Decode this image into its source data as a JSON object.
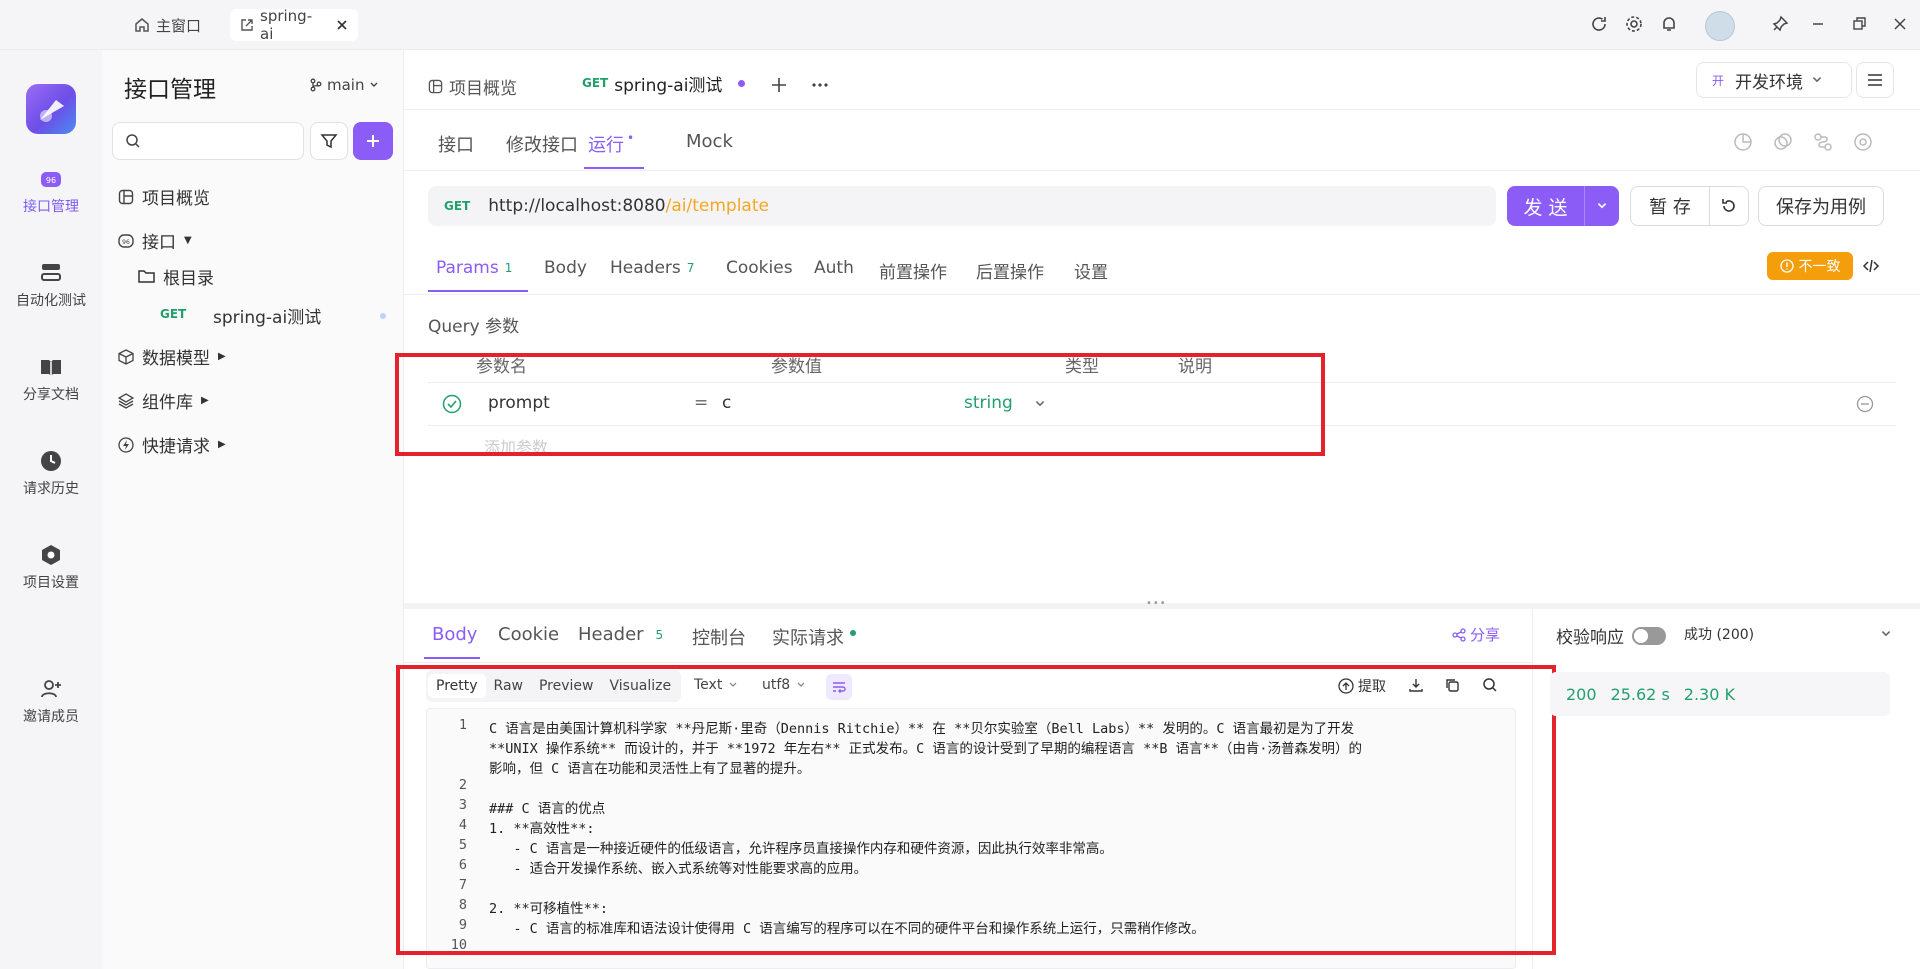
{
  "titlebar": {
    "home_tab": "主窗口",
    "doc_tab": "spring-ai"
  },
  "rail": {
    "items": [
      {
        "label": "接口管理",
        "icon": "api-management-icon"
      },
      {
        "label": "自动化测试",
        "icon": "automation-test-icon"
      },
      {
        "label": "分享文档",
        "icon": "share-docs-icon"
      },
      {
        "label": "请求历史",
        "icon": "history-icon"
      },
      {
        "label": "项目设置",
        "icon": "project-settings-icon"
      },
      {
        "label": "邀请成员",
        "icon": "invite-member-icon"
      }
    ]
  },
  "sidebar": {
    "title": "接口管理",
    "branch": "main",
    "search_placeholder": "",
    "tree": {
      "overview": "项目概览",
      "api": "接口",
      "root": "根目录",
      "endpoint_method": "GET",
      "endpoint_name": "spring-ai测试",
      "data_model": "数据模型",
      "components": "组件库",
      "quick_request": "快捷请求"
    }
  },
  "header": {
    "overview_tab": "项目概览",
    "active_tab_method": "GET",
    "active_tab_name": "spring-ai测试",
    "env_badge": "开",
    "env_name": "开发环境"
  },
  "subtabs": [
    "接口",
    "修改接口",
    "运行",
    "Mock"
  ],
  "request": {
    "method": "GET",
    "url_base": "http://localhost:8080",
    "url_path": "/ai/template",
    "send": "发 送",
    "save_temp": "暂 存",
    "save_case": "保存为用例"
  },
  "param_tabs": {
    "params": "Params",
    "params_count": "1",
    "body": "Body",
    "headers": "Headers",
    "headers_count": "7",
    "cookies": "Cookies",
    "auth": "Auth",
    "pre": "前置操作",
    "post": "后置操作",
    "settings": "设置",
    "mismatch": "不一致"
  },
  "query": {
    "title": "Query 参数",
    "columns": [
      "参数名",
      "参数值",
      "类型",
      "说明"
    ],
    "row": {
      "name": "prompt",
      "eq": "=",
      "value": "c",
      "type": "string"
    },
    "add_placeholder": "添加参数"
  },
  "response": {
    "tabs": {
      "body": "Body",
      "cookie": "Cookie",
      "header": "Header",
      "header_count": "5",
      "console": "控制台",
      "actual": "实际请求"
    },
    "share": "分享",
    "view_modes": [
      "Pretty",
      "Raw",
      "Preview",
      "Visualize"
    ],
    "format": "Text",
    "encoding": "utf8",
    "extract": "提取",
    "validate_label": "校验响应",
    "status_text": "成功 (200)",
    "status_code": "200",
    "time": "25.62 s",
    "size": "2.30 K",
    "code_lines": [
      {
        "n": "1",
        "t": "C 语言是由美国计算机科学家 **丹尼斯·里奇（Dennis Ritchie）** 在 **贝尔实验室（Bell Labs）** 发明的。C 语言最初是为了开发"
      },
      {
        "n": "",
        "t": "**UNIX 操作系统** 而设计的，并于 **1972 年左右** 正式发布。C 语言的设计受到了早期的编程语言 **B 语言**（由肯·汤普森发明）的"
      },
      {
        "n": "",
        "t": "影响，但 C 语言在功能和灵活性上有了显著的提升。"
      },
      {
        "n": "2",
        "t": ""
      },
      {
        "n": "3",
        "t": "### C 语言的优点"
      },
      {
        "n": "4",
        "t": "1. **高效性**:"
      },
      {
        "n": "5",
        "t": "   - C 语言是一种接近硬件的低级语言，允许程序员直接操作内存和硬件资源，因此执行效率非常高。"
      },
      {
        "n": "6",
        "t": "   - 适合开发操作系统、嵌入式系统等对性能要求高的应用。"
      },
      {
        "n": "7",
        "t": ""
      },
      {
        "n": "8",
        "t": "2. **可移植性**:"
      },
      {
        "n": "9",
        "t": "   - C 语言的标准库和语法设计使得用 C 语言编写的程序可以在不同的硬件平台和操作系统上运行，只需稍作修改。"
      },
      {
        "n": "10",
        "t": ""
      }
    ]
  },
  "colors": {
    "accent": "#8b5cf6",
    "get": "#22a06b",
    "annotation": "#e4222b",
    "warning": "#f59e0b"
  }
}
